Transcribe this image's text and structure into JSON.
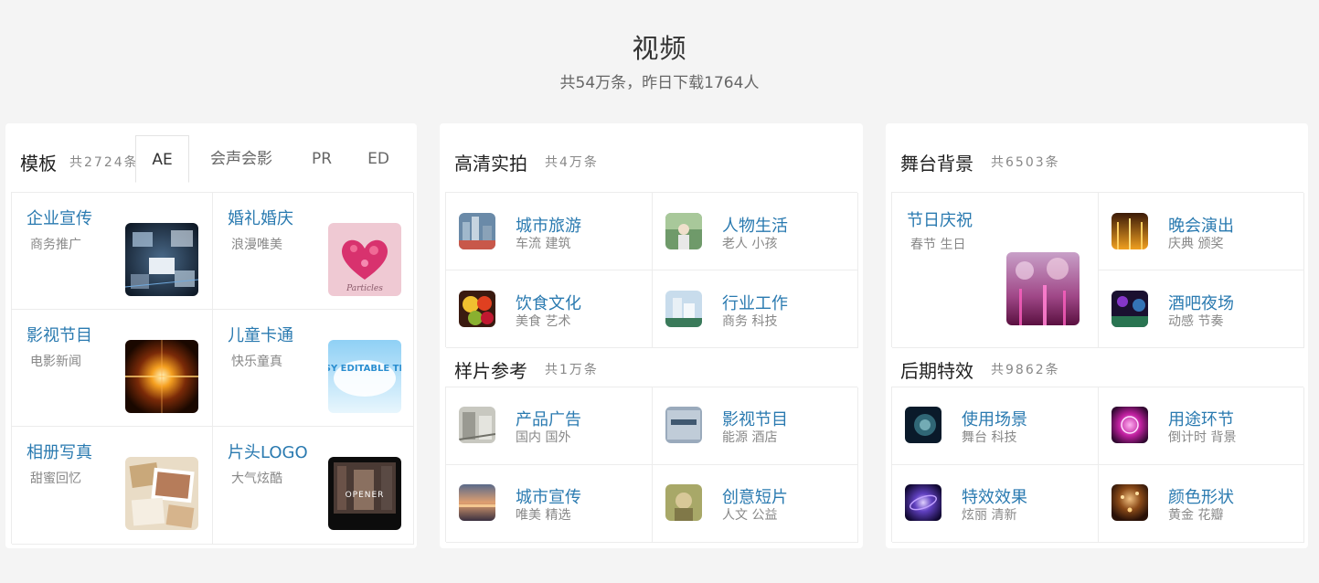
{
  "header": {
    "title": "视频",
    "subtitle": "共54万条，昨日下载1764人"
  },
  "templates": {
    "title": "模板",
    "count": "共2724条",
    "tabs": [
      {
        "label": "AE",
        "active": true
      },
      {
        "label": "会声会影",
        "active": false
      },
      {
        "label": "PR",
        "active": false
      },
      {
        "label": "ED",
        "active": false
      }
    ],
    "items": [
      {
        "name": "企业宣传",
        "sub": "商务推广"
      },
      {
        "name": "婚礼婚庆",
        "sub": "浪漫唯美",
        "thumb_text": "Particles"
      },
      {
        "name": "影视节目",
        "sub": "电影新闻"
      },
      {
        "name": "儿童卡通",
        "sub": "快乐童真",
        "thumb_text": "EASY EDITABLE TEXT"
      },
      {
        "name": "相册写真",
        "sub": "甜蜜回忆"
      },
      {
        "name": "片头LOGO",
        "sub": "大气炫酷",
        "thumb_text": "OPENER"
      }
    ]
  },
  "hd": {
    "title": "高清实拍",
    "count": "共4万条",
    "items": [
      {
        "name": "城市旅游",
        "sub": "车流 建筑"
      },
      {
        "name": "人物生活",
        "sub": "老人 小孩"
      },
      {
        "name": "饮食文化",
        "sub": "美食 艺术"
      },
      {
        "name": "行业工作",
        "sub": "商务 科技"
      }
    ]
  },
  "samples": {
    "title": "样片参考",
    "count": "共1万条",
    "items": [
      {
        "name": "产品广告",
        "sub": "国内 国外"
      },
      {
        "name": "影视节目",
        "sub": "能源 酒店"
      },
      {
        "name": "城市宣传",
        "sub": "唯美 精选"
      },
      {
        "name": "创意短片",
        "sub": "人文 公益"
      }
    ]
  },
  "stage": {
    "title": "舞台背景",
    "count": "共6503条",
    "featured": {
      "name": "节日庆祝",
      "sub": "春节 生日"
    },
    "items": [
      {
        "name": "晚会演出",
        "sub": "庆典 颁奖"
      },
      {
        "name": "酒吧夜场",
        "sub": "动感 节奏"
      }
    ]
  },
  "effects": {
    "title": "后期特效",
    "count": "共9862条",
    "items": [
      {
        "name": "使用场景",
        "sub": "舞台 科技"
      },
      {
        "name": "用途环节",
        "sub": "倒计时 背景"
      },
      {
        "name": "特效效果",
        "sub": "炫丽 清新"
      },
      {
        "name": "颜色形状",
        "sub": "黄金 花瓣"
      }
    ]
  }
}
